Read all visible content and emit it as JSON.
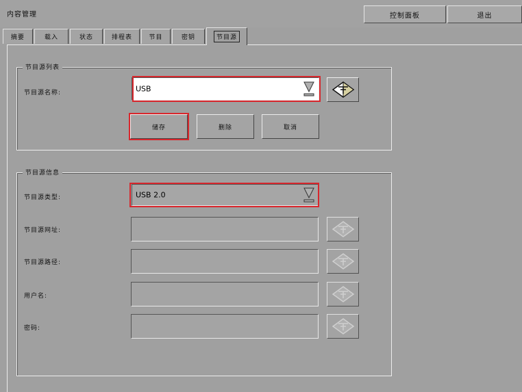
{
  "header": {
    "title": "内容管理",
    "control_panel_label": "控制面板",
    "exit_label": "退出"
  },
  "tabs": [
    {
      "label": "摘要"
    },
    {
      "label": "载入"
    },
    {
      "label": "状态"
    },
    {
      "label": "排程表"
    },
    {
      "label": "节目"
    },
    {
      "label": "密钥"
    },
    {
      "label": "节目源",
      "active": true
    }
  ],
  "source_list": {
    "group_title": "节目源列表",
    "name_label": "节目源名称:",
    "name_value": "USB",
    "save_label": "储存",
    "delete_label": "删除",
    "cancel_label": "取消"
  },
  "source_info": {
    "group_title": "节目源信息",
    "type_label": "节目源类型:",
    "type_value": "USB 2.0",
    "url_label": "节目源网址:",
    "url_value": "",
    "path_label": "节目源路径:",
    "path_value": "",
    "username_label": "用户名:",
    "username_value": "",
    "password_label": "密码:",
    "password_value": ""
  },
  "colors": {
    "highlight": "#d8262c",
    "background": "#a0a0a0"
  },
  "icons": {
    "dropdown": "triangle-down-icon",
    "edit": "diamond-pencil-icon"
  }
}
